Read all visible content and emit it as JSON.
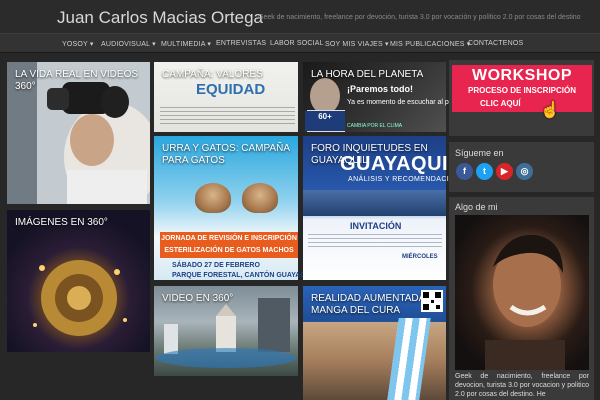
{
  "header": {
    "title": "Juan Carlos Macias Ortega",
    "tagline": "Geek de nacimiento, freelance por devoción, turista 3.0 por vocación y político 2.0 por cosas del destino"
  },
  "nav": {
    "items": [
      "YOSOY ▾",
      "AUDIOVISUAL ▾",
      "MULTIMEDIA ▾",
      "ENTREVISTAS",
      "LABOR SOCIAL",
      "SOY MIS VIAJES ▾",
      "MIS PUBLICACIONES ▾",
      "CONTACTENOS"
    ]
  },
  "tiles": {
    "vr": {
      "title": "LA VIDA REAL EN VIDEOS 360°"
    },
    "img360": {
      "title": "IMÁGENES EN 360°"
    },
    "equidad": {
      "title": "CAMPAÑA: VALORES",
      "logo": "EQUIDAD"
    },
    "planeta": {
      "title": "LA HORA DEL PLANETA",
      "headline": "¡Paremos todo!",
      "subline": "Ya es momento de escuchar al planeta",
      "badge": "60+",
      "footer": "CAMBIA POR EL CLIMA"
    },
    "workshop": {
      "title": "WORKSHOP",
      "subtitle": "PROCESO DE INSCRIPCIÓN",
      "cta": "CLIC AQUÍ"
    },
    "gatos": {
      "title": "URRA Y GATOS: CAMPAÑA PARA GATOS",
      "banner_line1": "JORNADA DE REVISIÓN E INSCRIPCIÓN",
      "banner_line2": "ESTERILIZACIÓN DE GATOS MACHOS",
      "date": "SÁBADO 27 DE FEBRERO",
      "place": "PARQUE FORESTAL, CANTÓN GUAYAQUIL"
    },
    "foro": {
      "title": "FORO INQUIETUDES EN GUAYAQUIL",
      "big": "GUAYAQUIL",
      "sub": "ANÁLISIS Y RECOMENDACIONES",
      "invite": "INVITACIÓN",
      "day": "MIÉRCOLES"
    },
    "video360": {
      "title": "VIDEO EN 360°"
    },
    "realidad": {
      "title": "REALIDAD AUMENTADA MANGA DEL CURA"
    }
  },
  "sidebar": {
    "follow_title": "Sígueme en",
    "social": [
      {
        "name": "facebook",
        "glyph": "f",
        "color": "#3b5998"
      },
      {
        "name": "twitter",
        "glyph": "t",
        "color": "#1da1f2"
      },
      {
        "name": "youtube",
        "glyph": "▶",
        "color": "#d9252a"
      },
      {
        "name": "instagram",
        "glyph": "◎",
        "color": "#3f6f98"
      }
    ],
    "bio_title": "Algo de mi",
    "bio_text": "Geek de nacimiento, freelance por devocion, turista 3.0 por vocacion y politico 2.0 por cosas del destino. He"
  }
}
